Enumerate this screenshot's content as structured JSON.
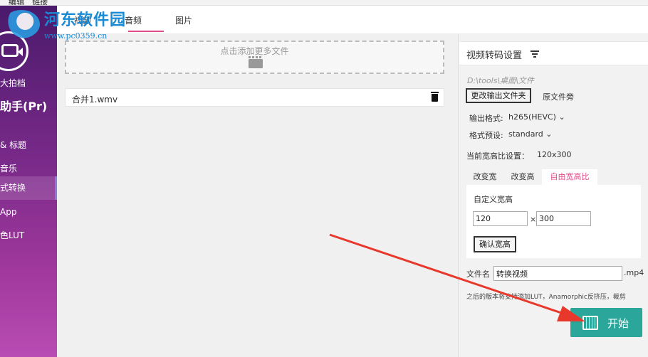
{
  "menubar": {
    "items": [
      "编辑",
      "链接"
    ]
  },
  "watermark": {
    "title": "河东软件园",
    "url": "www.pc0359.cn"
  },
  "sidebar": {
    "brand": "大拍档",
    "app_name": "助手(Pr)",
    "items": [
      {
        "label": "& 标题",
        "active": false
      },
      {
        "label": "音乐",
        "active": false
      },
      {
        "label": "式转换",
        "active": true
      },
      {
        "label": "App",
        "active": false
      },
      {
        "label": "色LUT",
        "active": false
      }
    ]
  },
  "tabs": {
    "items": [
      "视频",
      "音频",
      "图片"
    ]
  },
  "main": {
    "dropzone_text": "点击添加更多文件",
    "files": [
      {
        "name": "合并1.wmv"
      }
    ]
  },
  "panel": {
    "title": "视频转码设置",
    "output_path": "D:\\tools\\桌面\\文件",
    "change_output_button": "更改输出文件夹",
    "source_folder_option": "原文件旁",
    "output_format_label": "输出格式:",
    "output_format_value": "h265(HEVC)",
    "preset_label": "格式预设:",
    "preset_value": "standard",
    "current_ratio_label": "当前宽高比设置：",
    "current_ratio_value": "120x300",
    "ratio_tabs": [
      "改变宽",
      "改变高",
      "自由宽高比"
    ],
    "custom_size_label": "自定义宽高",
    "width_value": "120",
    "height_value": "300",
    "times_sign": "×",
    "confirm_button": "确认宽高",
    "filename_label": "文件名",
    "filename_value": "转换视频",
    "extension": ".mp4",
    "note": "之后的版本将支持添加LUT，Anamorphic反挤压，裁剪",
    "start_button": "开始"
  },
  "colors": {
    "accent": "#e04b8a",
    "start": "#2aa69a",
    "arrow": "#e8382c"
  }
}
